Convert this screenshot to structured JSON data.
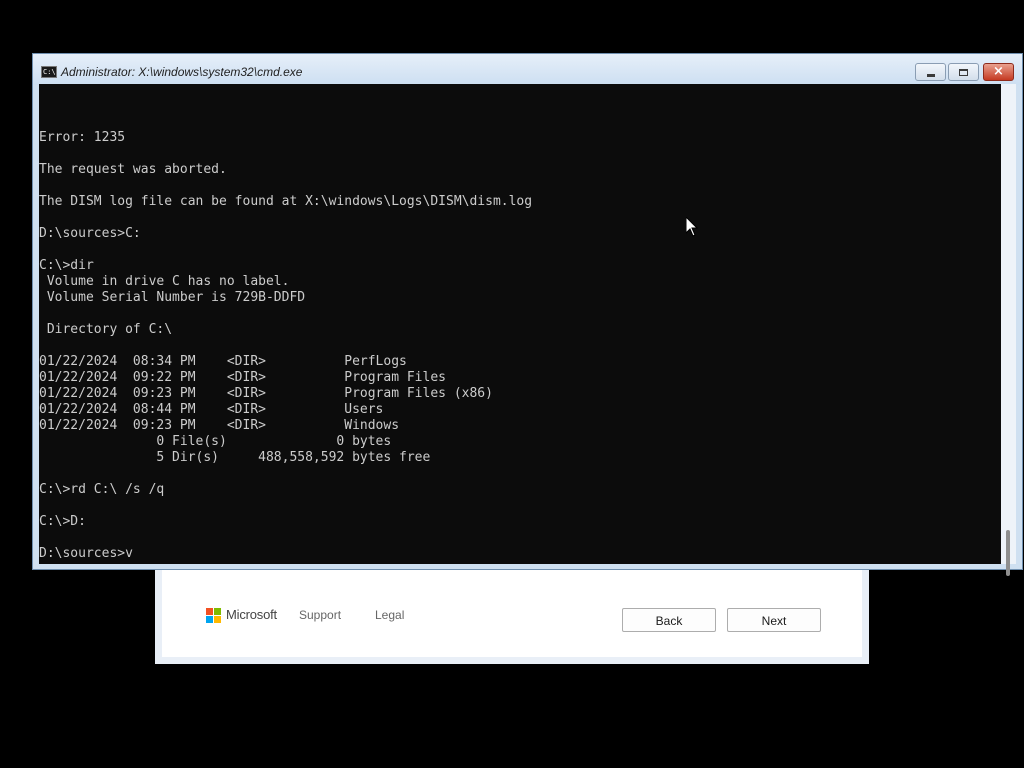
{
  "setup": {
    "brand": "Microsoft",
    "links": {
      "support": "Support",
      "legal": "Legal"
    },
    "buttons": {
      "back": "Back",
      "next": "Next"
    },
    "logo_colors": [
      "#f25022",
      "#7fba00",
      "#00a4ef",
      "#ffb900"
    ]
  },
  "cmd": {
    "title": "Administrator: X:\\windows\\system32\\cmd.exe",
    "icon_label": "C:\\",
    "controls": {
      "close": "×"
    },
    "lines": [
      "Error: 1235",
      "",
      "The request was aborted.",
      "",
      "The DISM log file can be found at X:\\windows\\Logs\\DISM\\dism.log",
      "",
      "D:\\sources>C:",
      "",
      "C:\\>dir",
      " Volume in drive C has no label.",
      " Volume Serial Number is 729B-DDFD",
      "",
      " Directory of C:\\",
      "",
      "01/22/2024  08:34 PM    <DIR>          PerfLogs",
      "01/22/2024  09:22 PM    <DIR>          Program Files",
      "01/22/2024  09:23 PM    <DIR>          Program Files (x86)",
      "01/22/2024  08:44 PM    <DIR>          Users",
      "01/22/2024  09:23 PM    <DIR>          Windows",
      "               0 File(s)              0 bytes",
      "               5 Dir(s)     488,558,592 bytes free",
      "",
      "C:\\>rd C:\\ /s /q",
      "",
      "C:\\>D:",
      "",
      "D:\\sources>v"
    ],
    "colors": {
      "console_bg": "#0c0c0c",
      "console_text": "#cccccc",
      "close_button": "#c53a22"
    }
  }
}
